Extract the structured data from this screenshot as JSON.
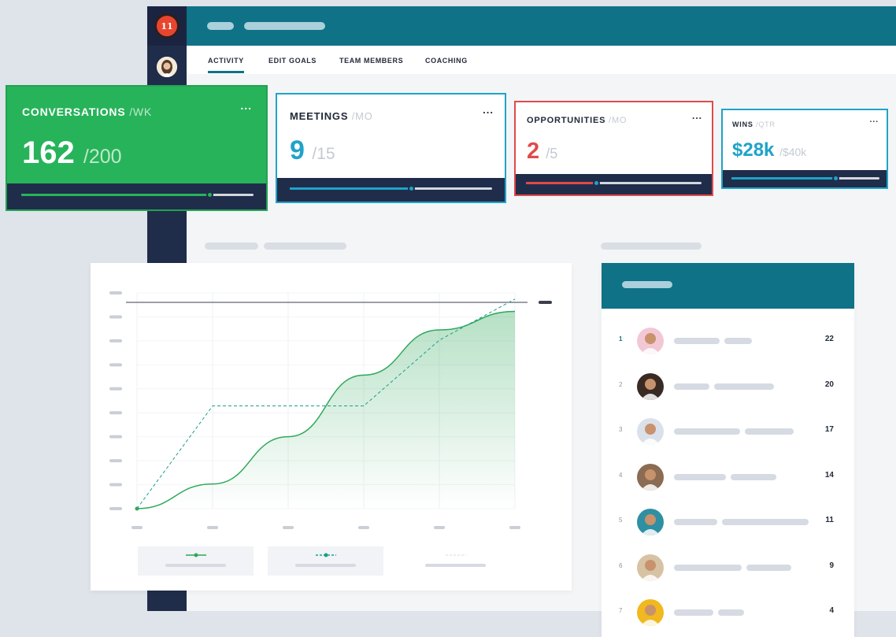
{
  "app": {
    "logo_text": "11",
    "tabs": [
      {
        "label": "ACTIVITY",
        "active": true
      },
      {
        "label": "EDIT GOALS",
        "active": false
      },
      {
        "label": "TEAM MEMBERS",
        "active": false
      },
      {
        "label": "COACHING",
        "active": false
      }
    ],
    "accent_color": "#0f7287",
    "sidebar_color": "#1f2d4a"
  },
  "cards": {
    "conversations": {
      "label": "CONVERSATIONS",
      "unit": "/WK",
      "value": "162",
      "target": "/200",
      "progress": 0.81,
      "color": "#27b35a",
      "menu": "..."
    },
    "meetings": {
      "label": "MEETINGS",
      "unit": "/MO",
      "value": "9",
      "target": "/15",
      "progress": 0.6,
      "color": "#1fa3c9",
      "menu": "..."
    },
    "opportunities": {
      "label": "OPPORTUNITIES",
      "unit": "/MO",
      "value": "2",
      "target": "/5",
      "progress": 0.4,
      "color": "#e04a4a",
      "menu": "..."
    },
    "wins": {
      "label": "WINS",
      "unit": "/QTR",
      "value": "$28k",
      "target": "/$40k",
      "progress": 0.7,
      "color": "#1fa3c9",
      "menu": "..."
    }
  },
  "chart_data": {
    "type": "line",
    "series": [
      {
        "values": [
          0,
          0.12,
          0.35,
          0.65,
          0.87,
          0.96
        ],
        "style": "solid-area",
        "color": "#2fa85a"
      },
      {
        "values": [
          0,
          0.5,
          0.5,
          0.5,
          0.82,
          1.02
        ],
        "style": "dashed",
        "color": "#1a9f8a"
      }
    ],
    "goal_line": 1.0,
    "ylim": [
      0,
      1.05
    ],
    "grid": true
  },
  "leaderboard": {
    "rows": [
      {
        "rank": "1",
        "score": "22",
        "avatar": "avatar-1-icon",
        "color": "#f2c8d4"
      },
      {
        "rank": "2",
        "score": "20",
        "avatar": "avatar-2-icon",
        "color": "#3a2a24"
      },
      {
        "rank": "3",
        "score": "17",
        "avatar": "avatar-3-icon",
        "color": "#dbe1ea"
      },
      {
        "rank": "4",
        "score": "14",
        "avatar": "avatar-4-icon",
        "color": "#8b6b52"
      },
      {
        "rank": "5",
        "score": "11",
        "avatar": "avatar-5-icon",
        "color": "#2f8fa3"
      },
      {
        "rank": "6",
        "score": "9",
        "avatar": "avatar-6-icon",
        "color": "#d7c3a3"
      },
      {
        "rank": "7",
        "score": "4",
        "avatar": "avatar-7-icon",
        "color": "#f1b81f"
      }
    ]
  }
}
